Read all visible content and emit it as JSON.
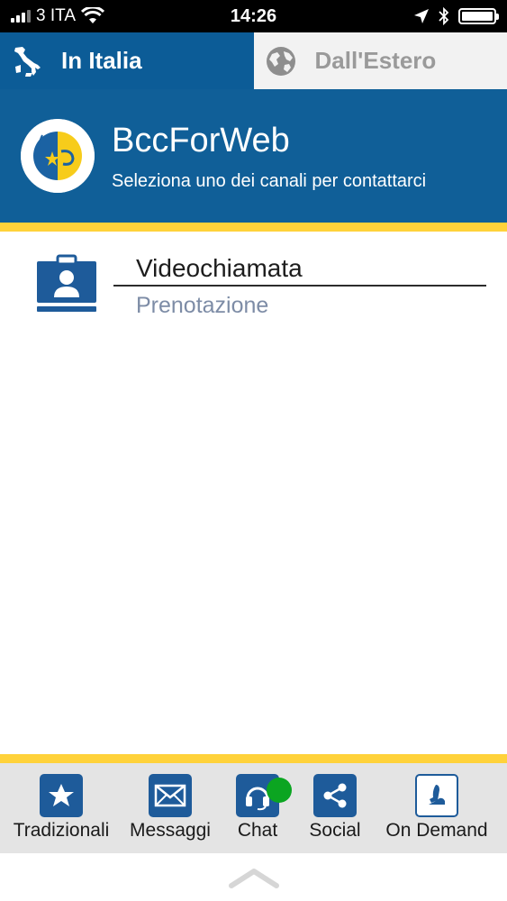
{
  "status_bar": {
    "carrier": "3 ITA",
    "time": "14:26",
    "signal_bars": 4,
    "signal_active": 3,
    "battery_level": 1.0
  },
  "tabs": [
    {
      "label": "In Italia",
      "icon": "italy-map-icon",
      "active": true
    },
    {
      "label": "Dall'Estero",
      "icon": "globe-icon",
      "active": false
    }
  ],
  "header": {
    "title": "BccForWeb",
    "subtitle": "Seleziona uno dei canali per contattarci",
    "logo": "bcc-logo"
  },
  "channel": {
    "title": "Videochiamata",
    "subtitle": "Prenotazione",
    "icon": "video-call-icon"
  },
  "bottom_nav": [
    {
      "label": "Tradizionali",
      "icon": "star-icon"
    },
    {
      "label": "Messaggi",
      "icon": "envelope-icon"
    },
    {
      "label": "Chat",
      "icon": "headset-icon",
      "online": true
    },
    {
      "label": "Social",
      "icon": "share-icon"
    },
    {
      "label": "On Demand",
      "icon": "seat-icon"
    }
  ],
  "colors": {
    "primary_blue": "#105f98",
    "tab_blue": "#0c5c97",
    "accent_yellow": "#ffd23a",
    "online_green": "#0ba521",
    "subtitle_gray_blue": "#7d8ca6"
  }
}
